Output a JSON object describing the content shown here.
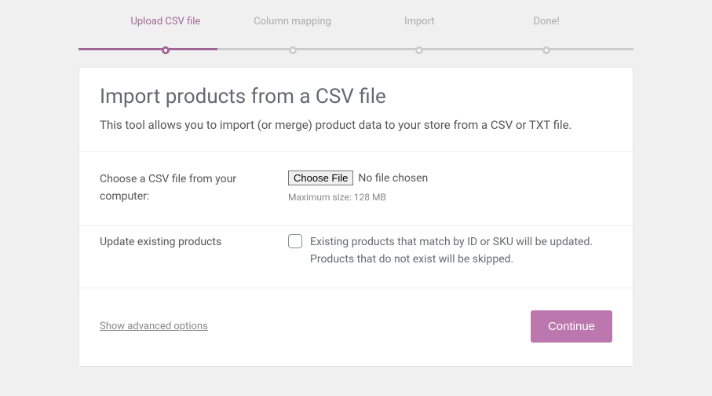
{
  "stepper": {
    "steps": [
      {
        "label": "Upload CSV file",
        "active": true
      },
      {
        "label": "Column mapping",
        "active": false
      },
      {
        "label": "Import",
        "active": false
      },
      {
        "label": "Done!",
        "active": false
      }
    ]
  },
  "header": {
    "title": "Import products from a CSV file",
    "lead": "This tool allows you to import (or merge) product data to your store from a CSV or TXT file."
  },
  "upload": {
    "label": "Choose a CSV file from your computer:",
    "button": "Choose File",
    "status": "No file chosen",
    "hint": "Maximum size: 128 MB"
  },
  "update": {
    "label": "Update existing products",
    "desc": "Existing products that match by ID or SKU will be updated. Products that do not exist will be skipped."
  },
  "footer": {
    "advanced": "Show advanced options",
    "continue": "Continue"
  }
}
